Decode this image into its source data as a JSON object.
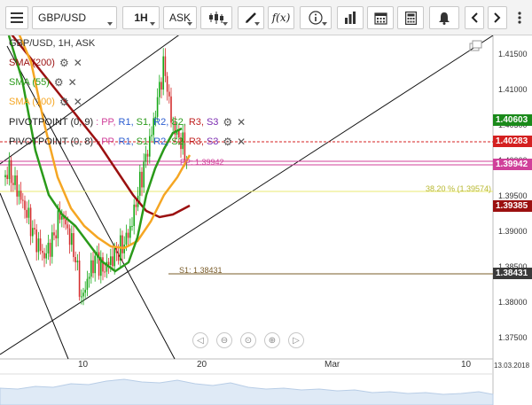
{
  "toolbar": {
    "symbol": "GBP/USD",
    "timeframe": "1H",
    "price_type": "ASK",
    "fx_label": "f(x)"
  },
  "legend": {
    "title": "GBP/USD, 1H, ASK",
    "sma200": "SMA (200)",
    "sma55": "SMA (55)",
    "sma100": "SMA (100)",
    "pivot1": {
      "name": "PIVOTPOINT (0, 9)",
      "sep": ":",
      "pp": "PP,",
      "r1": "R1,",
      "s1": "S1,",
      "r2": "R2,",
      "s2": "S2,",
      "r3": "R3,",
      "s3": "S3"
    },
    "pivot2": {
      "name": "PIVOTPOINT (0, 8)",
      "sep": ":",
      "pp": "PP,",
      "r1": "R1,",
      "s1": "S1,",
      "r2": "R2,",
      "s2": "S2,",
      "r3": "R3,",
      "s3": "S3"
    }
  },
  "price_axis": [
    "1.41500",
    "1.41000",
    "1.40500",
    "1.40000",
    "1.39500",
    "1.39000",
    "1.38500",
    "1.38000",
    "1.37500"
  ],
  "price_tags": {
    "t1": "1.40603",
    "t2": "1.40283",
    "t3": "1.39942",
    "t4": "1.39385",
    "t5": "1.38431"
  },
  "level_labels": {
    "pp": "PP: 1.39942",
    "fib": "38.20 % (1.39574)",
    "s1": "S1: 1.38431"
  },
  "time_axis": {
    "d10": "10",
    "d20": "20",
    "mar": "Mar",
    "m10": "10",
    "date": "13.03.2018"
  },
  "colors": {
    "sma200": "#9b1010",
    "sma55": "#2a9a1a",
    "sma100": "#f5a623",
    "price_up": "#18a818",
    "price_down": "#d43030",
    "tag_green": "#1a8a1a",
    "tag_red": "#d42020",
    "tag_dark": "#3a3a3a"
  }
}
